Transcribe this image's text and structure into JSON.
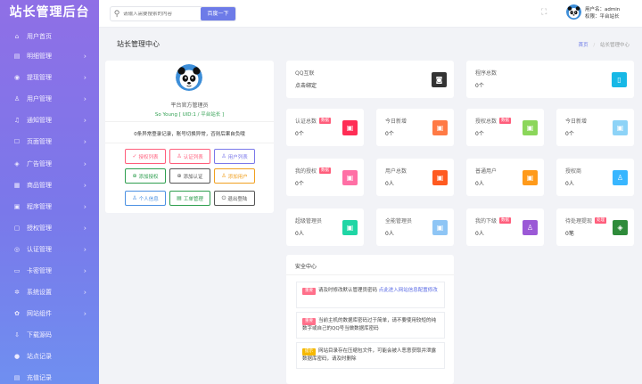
{
  "app": {
    "title": "站长管理后台"
  },
  "sidebar": {
    "items": [
      {
        "label": "用户首页",
        "icon": "home-icon",
        "glyph": "⌂",
        "chevron": false
      },
      {
        "label": "明细管理",
        "icon": "list-icon",
        "glyph": "▤",
        "chevron": true
      },
      {
        "label": "提现管理",
        "icon": "withdraw-icon",
        "glyph": "◉",
        "chevron": true
      },
      {
        "label": "用户管理",
        "icon": "user-icon",
        "glyph": "♙",
        "chevron": true
      },
      {
        "label": "通知管理",
        "icon": "bell-icon",
        "glyph": "♫",
        "chevron": true
      },
      {
        "label": "页面管理",
        "icon": "page-icon",
        "glyph": "☐",
        "chevron": true
      },
      {
        "label": "广告管理",
        "icon": "ad-icon",
        "glyph": "◈",
        "chevron": true
      },
      {
        "label": "商品管理",
        "icon": "goods-icon",
        "glyph": "▦",
        "chevron": true
      },
      {
        "label": "程序管理",
        "icon": "program-icon",
        "glyph": "▣",
        "chevron": true
      },
      {
        "label": "授权管理",
        "icon": "auth-icon",
        "glyph": "▢",
        "chevron": true
      },
      {
        "label": "认证管理",
        "icon": "shield-icon",
        "glyph": "◎",
        "chevron": true
      },
      {
        "label": "卡密管理",
        "icon": "card-icon",
        "glyph": "▭",
        "chevron": true
      },
      {
        "label": "系统设置",
        "icon": "gear-icon",
        "glyph": "✲",
        "chevron": true
      },
      {
        "label": "网站组件",
        "icon": "component-icon",
        "glyph": "✿",
        "chevron": true
      },
      {
        "label": "下载源码",
        "icon": "download-icon",
        "glyph": "⇩",
        "chevron": false
      },
      {
        "label": "站点记录",
        "icon": "record-icon",
        "glyph": "●",
        "chevron": false
      },
      {
        "label": "充值记录",
        "icon": "recharge-icon",
        "glyph": "▤",
        "chevron": false
      }
    ]
  },
  "topbar": {
    "search_placeholder": "请输入需要搜索的内容",
    "search_button": "百度一下",
    "user_line1": "用户名：admin",
    "user_line2": "权限：平台站长"
  },
  "page": {
    "title": "站长管理中心",
    "breadcrumb_home": "首页",
    "breadcrumb_sep": "/",
    "breadcrumb_current": "站长管理中心"
  },
  "profile": {
    "name": "平台官方管理员",
    "id_line": "So Young [ UID:1 / 平台站长 ]",
    "notice": "0条异常登录记录，账号切换异常，否则后果自负哦",
    "buttons": [
      {
        "label": "授权列表",
        "glyph": "✓",
        "color": "#ff5d7b"
      },
      {
        "label": "认证列表",
        "glyph": "♙",
        "color": "#ff5d7b"
      },
      {
        "label": "用户列表",
        "glyph": "♙",
        "color": "#7a78ea"
      },
      {
        "label": "添加授权",
        "glyph": "⊕",
        "color": "#2e9e4f"
      },
      {
        "label": "添加认证",
        "glyph": "⊕",
        "color": "#555555"
      },
      {
        "label": "添加用户",
        "glyph": "♙",
        "color": "#f0a020"
      },
      {
        "label": "个人信息",
        "glyph": "♙",
        "color": "#4a90e2"
      },
      {
        "label": "工单管理",
        "glyph": "▤",
        "color": "#2e9e4f"
      },
      {
        "label": "退出登陆",
        "glyph": "⏻",
        "color": "#555555"
      }
    ]
  },
  "cards": {
    "qq": {
      "title": "QQ互联",
      "value": "点击绑定",
      "color": "#333333",
      "glyph": "◙"
    },
    "programs": {
      "title": "程序总数",
      "value": "0个",
      "color": "#17b8e6",
      "glyph": "▯"
    },
    "stats": [
      {
        "title": "认证总数",
        "badge": "数据",
        "value": "0个",
        "color": "#ff2d55",
        "glyph": "▣"
      },
      {
        "title": "今日新增",
        "badge": "",
        "value": "0个",
        "color": "#ff7a45",
        "glyph": "▣"
      },
      {
        "title": "授权总数",
        "badge": "数据",
        "value": "0个",
        "color": "#8bd65a",
        "glyph": "▣"
      },
      {
        "title": "今日新增",
        "badge": "",
        "value": "0个",
        "color": "#8dd3f7",
        "glyph": "▣"
      },
      {
        "title": "我的授权",
        "badge": "数据",
        "value": "0个",
        "color": "#ff6fa5",
        "glyph": "▣"
      },
      {
        "title": "用户总数",
        "badge": "",
        "value": "0人",
        "color": "#ff5a20",
        "glyph": "▣"
      },
      {
        "title": "普通用户",
        "badge": "",
        "value": "0人",
        "color": "#ff9a1a",
        "glyph": "▣"
      },
      {
        "title": "授权商",
        "badge": "",
        "value": "0人",
        "color": "#38b6ff",
        "glyph": "♙"
      },
      {
        "title": "超级管理员",
        "badge": "",
        "value": "0人",
        "color": "#1fd6a5",
        "glyph": "▣"
      },
      {
        "title": "全能管理员",
        "badge": "",
        "value": "0人",
        "color": "#8ec5f5",
        "glyph": "▣"
      },
      {
        "title": "我的下级",
        "badge": "数据",
        "value": "0人",
        "color": "#9b59d6",
        "glyph": "♙"
      },
      {
        "title": "待处理提现",
        "badge": "处理",
        "value": "0笔",
        "color": "#2e8b3a",
        "glyph": "◈"
      }
    ]
  },
  "security": {
    "title": "安全中心",
    "rows": [
      {
        "tag": "重要",
        "tag_color": "#ff6f8a",
        "text": "请及时修改默认管理员密码 ",
        "link": "点此进入网站信息配置修改"
      },
      {
        "tag": "重要",
        "tag_color": "#ff6f8a",
        "text": "当前主机的数据库密码过于简单，请不要使用较短的纯数字或自己的QQ号当做数据库密码",
        "link": ""
      },
      {
        "tag": "提示",
        "tag_color": "#f5b800",
        "text": "网站目录存在压缩包文件，可能会被人恶意获取并泄露数据库密码，请及时删除",
        "link": ""
      }
    ]
  }
}
